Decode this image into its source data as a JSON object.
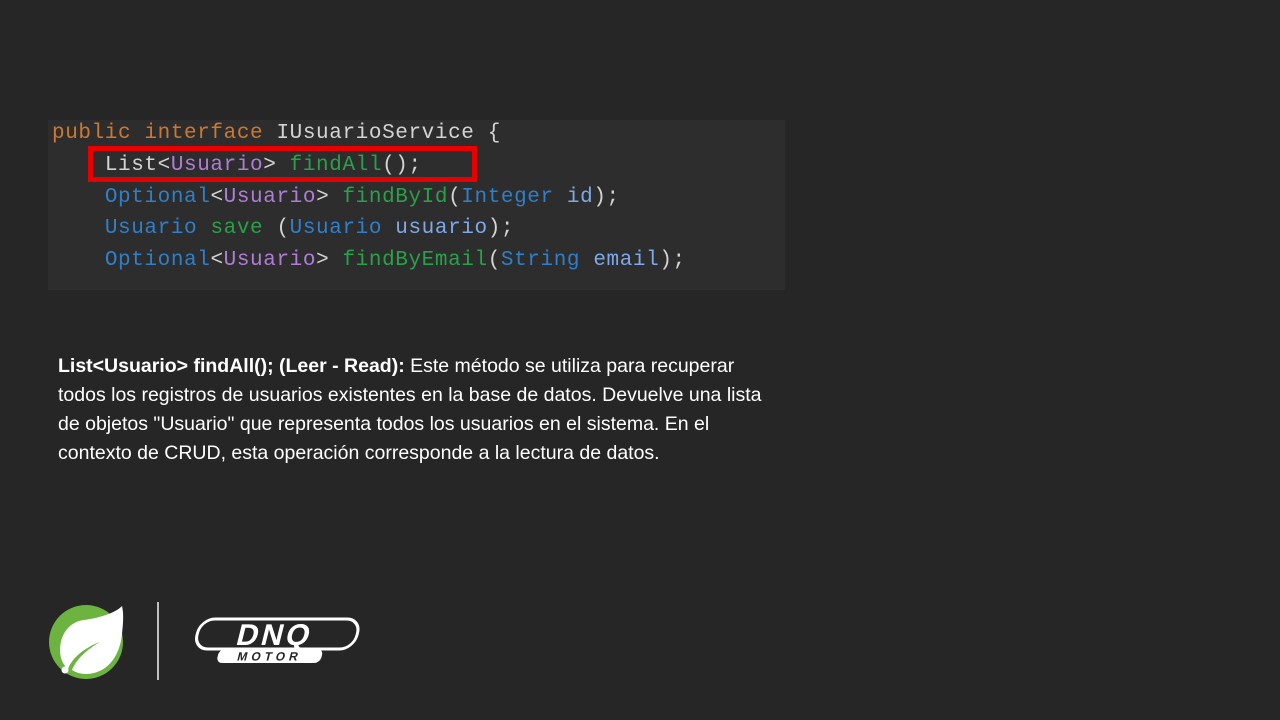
{
  "colors": {
    "background": "#262626",
    "code_background": "#2d2d2d",
    "keyword": "#cc7832",
    "type_blue": "#2f7fc9",
    "generic_purple": "#b07cd8",
    "method_green": "#28a148",
    "param_blue": "#7ea9e8",
    "highlight_red": "#e80000",
    "spring_green": "#6db33f"
  },
  "code": {
    "line1": {
      "kw_public": "public",
      "kw_interface": "interface",
      "name": "IUsuarioService",
      "brace": "{"
    },
    "line2": {
      "type": "List",
      "lt": "<",
      "generic": "Usuario",
      "gt": ">",
      "method": "findAll",
      "tail": "();"
    },
    "line3": {
      "type": "Optional",
      "lt": "<",
      "generic": "Usuario",
      "gt": ">",
      "method": "findById",
      "paren_open": "(",
      "param_type": "Integer",
      "param_name": "id",
      "tail": ");"
    },
    "line4": {
      "type": "Usuario",
      "method": "save",
      "paren_open": "(",
      "param_type": "Usuario",
      "param_name": "usuario",
      "tail": ");"
    },
    "line5": {
      "type": "Optional",
      "lt": "<",
      "generic": "Usuario",
      "gt": ">",
      "method": "findByEmail",
      "paren_open": "(",
      "param_type": "String",
      "param_name": "email",
      "tail": ");"
    }
  },
  "description": {
    "bold": "List<Usuario> findAll(); (Leer - Read):",
    "text": " Este método se utiliza para recuperar todos los registros de usuarios existentes en la base de datos. Devuelve una lista de objetos \"Usuario\" que representa todos los usuarios en el sistema. En el contexto de CRUD, esta operación corresponde a la lectura de datos."
  },
  "logos": {
    "spring": "spring-leaf-logo",
    "dnq_main": "DNQ",
    "dnq_sub": "MOTOR"
  }
}
